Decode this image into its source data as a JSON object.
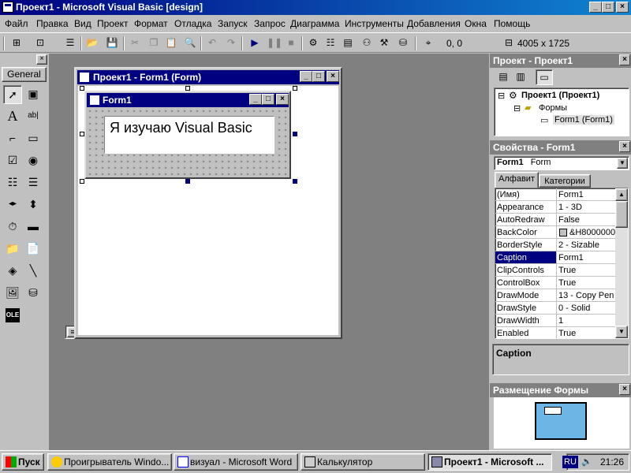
{
  "window": {
    "title": "Проект1 - Microsoft Visual Basic [design]",
    "buttons": {
      "minimize": "_",
      "maximize": "□",
      "close": "×"
    }
  },
  "menu": [
    "Файл",
    "Правка",
    "Вид",
    "Проект",
    "Формат",
    "Отладка",
    "Запуск",
    "Запрос",
    "Диаграмма",
    "Инструменты",
    "Добавления",
    "Окна",
    "Помощь"
  ],
  "toolbar": {
    "position": "0, 0",
    "size": "4005 x 1725"
  },
  "toolbox": {
    "close": "×",
    "tab_label": "General",
    "tools": {
      "pointer": "➚",
      "picture": "▣",
      "label": "A",
      "textbox": "ab|",
      "frame": "⌐",
      "commandbutton": "▭",
      "checkbox": "☑",
      "option": "◉",
      "combobox": "☷",
      "listbox": "☰",
      "hscroll": "◂▸",
      "vscroll": "⬍",
      "timer": "⏱",
      "drivelist": "▬",
      "dirlist": "📁",
      "filelist": "📄",
      "shape": "◈",
      "line": "╲",
      "image": "🖼",
      "data": "⛁",
      "ole": "OLE"
    }
  },
  "designer": {
    "caption": "Проект1 - Form1 (Form)",
    "form_caption": "Form1",
    "label_text": "Я изучаю Visual Basic"
  },
  "project_panel": {
    "title": "Проект - Проект1",
    "tree": {
      "root": "Проект1 (Проект1)",
      "folder": "Формы",
      "item": "Form1 (Form1)"
    }
  },
  "properties_panel": {
    "title": "Свойства - Form1",
    "object_name": "Form1",
    "object_type": "Form",
    "tabs": [
      "Алфавит",
      "Категории"
    ],
    "rows": [
      {
        "name": "(Имя)",
        "value": "Form1"
      },
      {
        "name": "Appearance",
        "value": "1 - 3D"
      },
      {
        "name": "AutoRedraw",
        "value": "False"
      },
      {
        "name": "BackColor",
        "value": "&H8000000"
      },
      {
        "name": "BorderStyle",
        "value": "2 - Sizable"
      },
      {
        "name": "Caption",
        "value": "Form1"
      },
      {
        "name": "ClipControls",
        "value": "True"
      },
      {
        "name": "ControlBox",
        "value": "True"
      },
      {
        "name": "DrawMode",
        "value": "13 - Copy Pen"
      },
      {
        "name": "DrawStyle",
        "value": "0 - Solid"
      },
      {
        "name": "DrawWidth",
        "value": "1"
      },
      {
        "name": "Enabled",
        "value": "True"
      }
    ],
    "selected_row": 5,
    "description": "Caption"
  },
  "layout_panel": {
    "title": "Размещение Формы"
  },
  "taskbar": {
    "start": "Пуск",
    "tasks": [
      {
        "label": "Проигрыватель Windo..."
      },
      {
        "label": "визуал - Microsoft Word"
      },
      {
        "label": "Калькулятор"
      },
      {
        "label": "Проект1 - Microsoft ..."
      }
    ],
    "lang": "RU",
    "clock": "21:26"
  }
}
